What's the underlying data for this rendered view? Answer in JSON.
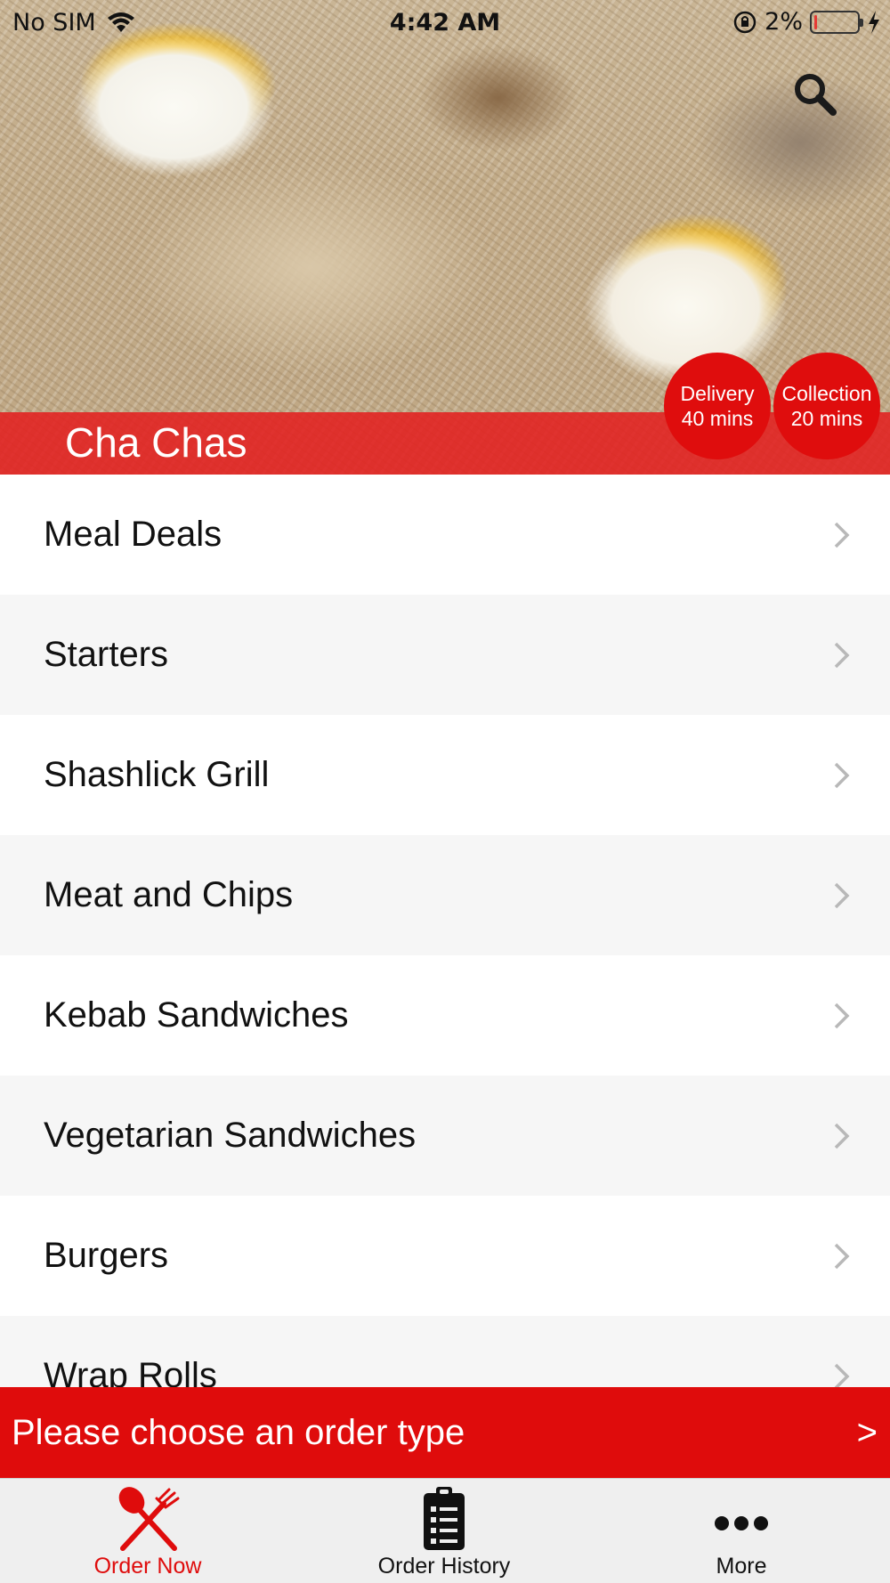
{
  "status_bar": {
    "carrier": "No SIM",
    "time": "4:42 AM",
    "battery": "2%",
    "battery_level": 0.02
  },
  "header": {
    "restaurant_name": "Cha Chas",
    "search_icon": "search-icon",
    "badges": [
      {
        "title": "Delivery",
        "time": "40 mins"
      },
      {
        "title": "Collection",
        "time": "20 mins"
      }
    ]
  },
  "menu": {
    "items": [
      {
        "label": "Meal Deals"
      },
      {
        "label": "Starters"
      },
      {
        "label": "Shashlick Grill"
      },
      {
        "label": "Meat and Chips"
      },
      {
        "label": "Kebab Sandwiches"
      },
      {
        "label": "Vegetarian Sandwiches"
      },
      {
        "label": "Burgers"
      },
      {
        "label": "Wrap Rolls"
      }
    ]
  },
  "order_bar": {
    "text": "Please choose an order type",
    "arrow": ">"
  },
  "tabs": [
    {
      "label": "Order Now",
      "icon": "fork-knife-icon",
      "active": true,
      "color": "#df0c0c"
    },
    {
      "label": "Order History",
      "icon": "clipboard-list-icon",
      "active": false
    },
    {
      "label": "More",
      "icon": "more-dots-icon",
      "active": false
    }
  ],
  "colors": {
    "accent": "#df0c0c",
    "band": "#e32020"
  }
}
